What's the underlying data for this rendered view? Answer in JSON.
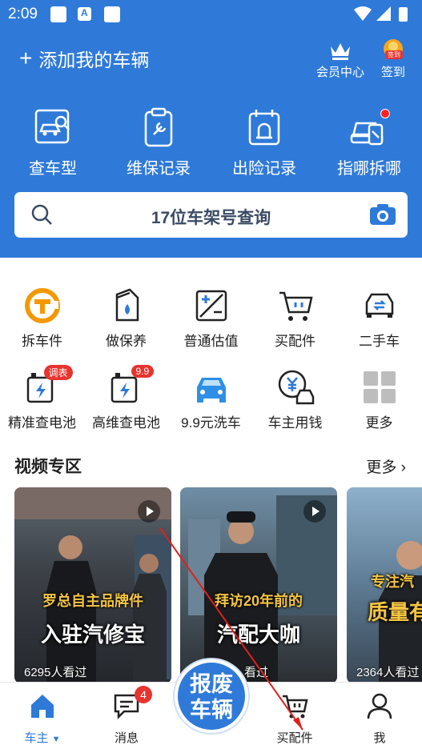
{
  "status": {
    "time": "2:09"
  },
  "header": {
    "add_vehicle": "添加我的车辆",
    "member_center": "会员中心",
    "check_in": "签到",
    "check_in_badge": "签到"
  },
  "quick_actions": [
    {
      "label": "查车型",
      "icon": "car-search-icon"
    },
    {
      "label": "维保记录",
      "icon": "wrench-clipboard-icon"
    },
    {
      "label": "出险记录",
      "icon": "alarm-calendar-icon"
    },
    {
      "label": "指哪拆哪",
      "icon": "car-parts-icon"
    }
  ],
  "search": {
    "placeholder": "17位车架号查询"
  },
  "services_row1": [
    {
      "label": "拆车件",
      "icon": "dismantle-parts-icon"
    },
    {
      "label": "做保养",
      "icon": "oil-maintenance-icon"
    },
    {
      "label": "普通估值",
      "icon": "valuation-icon"
    },
    {
      "label": "买配件",
      "icon": "cart-icon"
    },
    {
      "label": "二手车",
      "icon": "used-car-icon"
    }
  ],
  "services_row2": [
    {
      "label": "精准查电池",
      "icon": "battery-icon",
      "tag": "调表"
    },
    {
      "label": "高维查电池",
      "icon": "battery-icon",
      "tag": "9.9"
    },
    {
      "label": "9.9元洗车",
      "icon": "car-wash-icon"
    },
    {
      "label": "车主用钱",
      "icon": "car-loan-icon"
    },
    {
      "label": "更多",
      "icon": "more-grid-icon"
    }
  ],
  "video_section": {
    "title": "视频专区",
    "more": "更多",
    "videos": [
      {
        "caption1": "罗总自主品牌件",
        "caption2": "入驻汽修宝",
        "views": "6295人看过"
      },
      {
        "caption1": "拜访20年前的",
        "caption2": "汽配大咖",
        "views": "看过"
      },
      {
        "caption1": "专注汽",
        "caption2": "质量有",
        "views": "2364人看过"
      }
    ]
  },
  "tabbar": {
    "home": "车主",
    "messages": "消息",
    "messages_badge": "4",
    "scrap_line1": "报废",
    "scrap_line2": "车辆",
    "parts": "买配件",
    "me": "我"
  },
  "colors": {
    "brand": "#2f7ad9",
    "accent": "#f39800",
    "badge": "#e8332e"
  }
}
